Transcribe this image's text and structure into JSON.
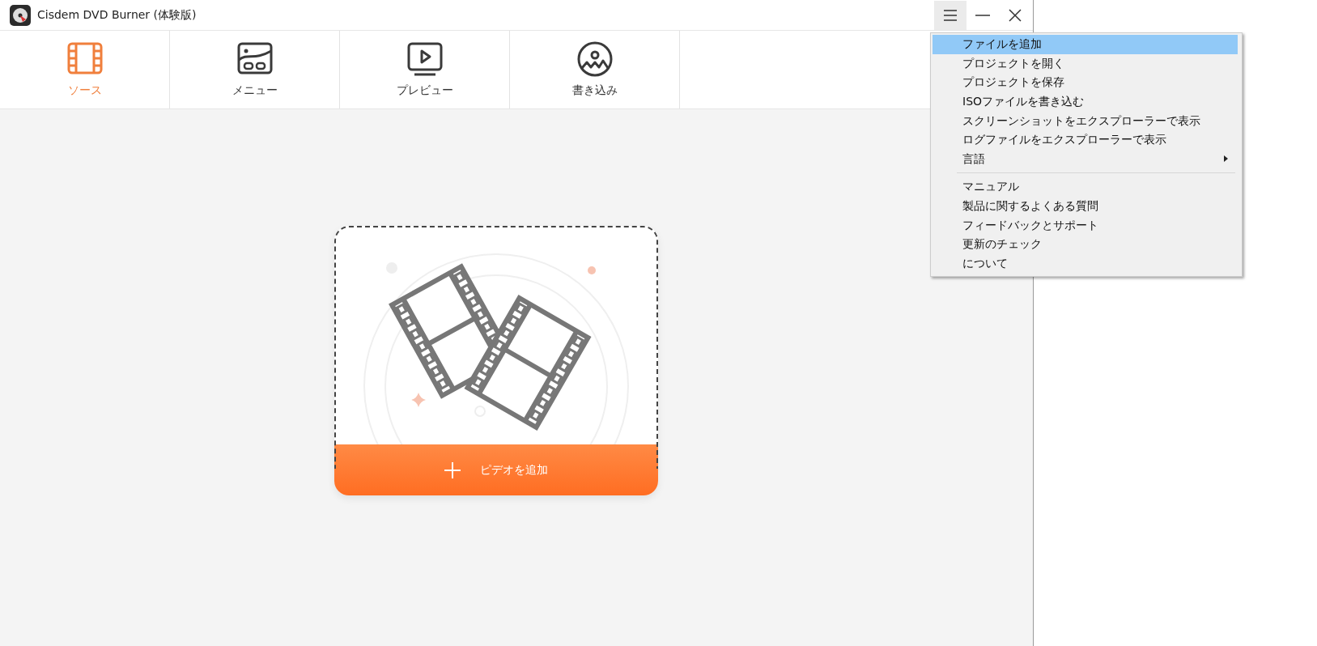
{
  "window": {
    "title": "Cisdem DVD Burner (体験版)"
  },
  "tabs": [
    {
      "label": "ソース",
      "kind": "film",
      "selected": true
    },
    {
      "label": "メニュー",
      "kind": "menu",
      "selected": false
    },
    {
      "label": "プレビュー",
      "kind": "preview",
      "selected": false
    },
    {
      "label": "書き込み",
      "kind": "burn",
      "selected": false
    }
  ],
  "drop_zone": {
    "button": "ピデオを追加"
  },
  "menu": {
    "sections": [
      [
        {
          "label": "ファイルを追加",
          "kind": "item",
          "selected": true
        },
        {
          "label": "プロジェクトを開く",
          "kind": "item",
          "selected": false
        },
        {
          "label": "プロジェクトを保存",
          "kind": "item",
          "selected": false
        },
        {
          "label": "ISOファイルを書き込む",
          "kind": "item",
          "selected": false
        },
        {
          "label": "スクリーンショットをエクスプローラーで表示",
          "kind": "item",
          "selected": false
        },
        {
          "label": "ログファイルをエクスプローラーで表示",
          "kind": "item",
          "selected": false
        },
        {
          "label": "言語",
          "kind": "submenu",
          "selected": false
        }
      ],
      [
        {
          "label": "マニュアル",
          "kind": "item",
          "selected": false
        },
        {
          "label": "製品に関するよくある質問",
          "kind": "item",
          "selected": false
        },
        {
          "label": "フィードバックとサポート",
          "kind": "item",
          "selected": false
        },
        {
          "label": "更新のチェック",
          "kind": "item",
          "selected": false
        },
        {
          "label": "について",
          "kind": "item",
          "selected": false
        }
      ]
    ]
  }
}
